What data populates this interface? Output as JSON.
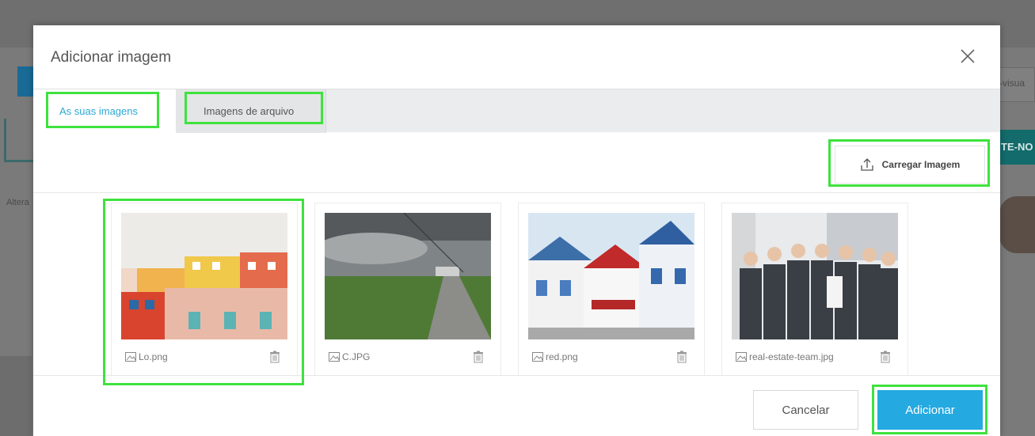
{
  "background": {
    "right_input_text": "-visua",
    "right_button_text": "TE-NO",
    "left_label": "Altera"
  },
  "modal": {
    "title": "Adicionar imagem",
    "tabs": [
      {
        "label": "As suas imagens",
        "active": true
      },
      {
        "label": "Imagens de arquivo",
        "active": false
      }
    ],
    "upload_label": "Carregar Imagem",
    "images": [
      {
        "filename": "Lo.png",
        "subject": "colorful-houses"
      },
      {
        "filename": "C.JPG",
        "subject": "cloudy-road-field"
      },
      {
        "filename": "red.png",
        "subject": "striped-beach-houses"
      },
      {
        "filename": "real-estate-team.jpg",
        "subject": "business-team"
      }
    ],
    "cancel_label": "Cancelar",
    "add_label": "Adicionar"
  },
  "colors": {
    "accent": "#24a9e1",
    "tab_active_text": "#2ea7d3",
    "highlight": "#3ee23e"
  }
}
